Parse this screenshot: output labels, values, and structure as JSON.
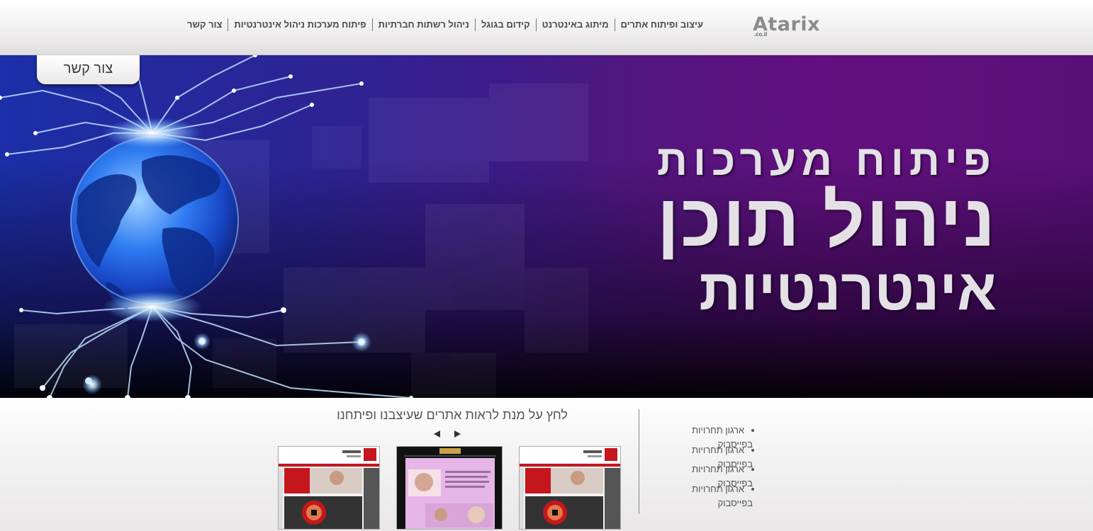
{
  "header": {
    "logo": {
      "name": "Atarix",
      "sub": ".co.il"
    },
    "nav": [
      {
        "label": "עיצוב ופיתוח אתרים"
      },
      {
        "label": "מיתוג באינטרנט"
      },
      {
        "label": "קידום בגוגל"
      },
      {
        "label": "ניהול רשתות חברתיות"
      },
      {
        "label": "פיתוח מערכות ניהול אינטרנטיות"
      },
      {
        "label": "צור קשר"
      }
    ]
  },
  "hero": {
    "contact_tab": "צור קשר",
    "headline": {
      "line1": "פיתוח מערכות",
      "line2": "ניהול תוכן",
      "line3": "אינטרנטיות"
    }
  },
  "bottom": {
    "services": [
      "ארגון תחרויות בפייסבוק",
      "ארגון תחרויות בפייסבוק",
      "ארגון תחרויות בפייסבוק",
      "ארגון תחרויות בפייסבוק"
    ],
    "portfolio": {
      "title": "לחץ על מנת לראות אתרים שעיצבנו ופיתחנו"
    }
  },
  "colors": {
    "hero_purple": "#62107f",
    "hero_blue": "#1b2fa8",
    "header_bg": "#f1f0f0",
    "text_dark": "#4a4a4a"
  },
  "icons": {
    "prev": "left-triangle-arrow",
    "next": "right-triangle-arrow",
    "globe": "globe-circuit-graphic"
  }
}
